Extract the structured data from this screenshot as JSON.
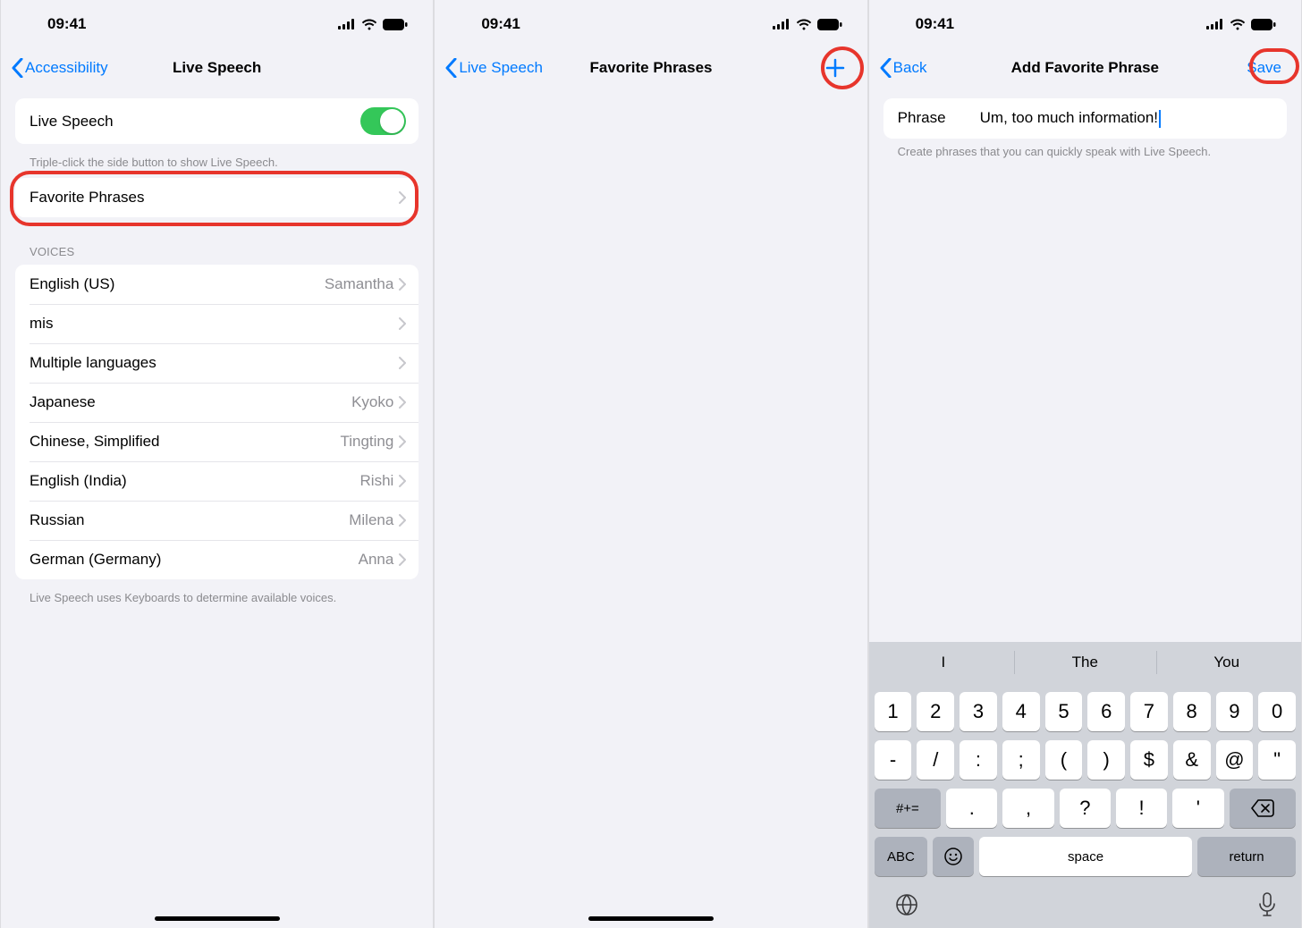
{
  "status": {
    "time": "09:41"
  },
  "screen1": {
    "back": "Accessibility",
    "title": "Live Speech",
    "toggleLabel": "Live Speech",
    "toggleFooter": "Triple-click the side button to show Live Speech.",
    "favorite": "Favorite Phrases",
    "voicesHeader": "Voices",
    "voices": [
      {
        "name": "English (US)",
        "detail": "Samantha"
      },
      {
        "name": "mis",
        "detail": ""
      },
      {
        "name": "Multiple languages",
        "detail": ""
      },
      {
        "name": "Japanese",
        "detail": "Kyoko"
      },
      {
        "name": "Chinese, Simplified",
        "detail": "Tingting"
      },
      {
        "name": "English (India)",
        "detail": "Rishi"
      },
      {
        "name": "Russian",
        "detail": "Milena"
      },
      {
        "name": "German (Germany)",
        "detail": "Anna"
      }
    ],
    "voicesFooter": "Live Speech uses Keyboards to determine available voices."
  },
  "screen2": {
    "back": "Live Speech",
    "title": "Favorite Phrases"
  },
  "screen3": {
    "back": "Back",
    "title": "Add Favorite Phrase",
    "save": "Save",
    "phraseLabel": "Phrase",
    "phraseValue": "Um, too much information!",
    "footer": "Create phrases that you can quickly speak with Live Speech.",
    "suggestions": [
      "I",
      "The",
      "You"
    ],
    "row1": [
      "1",
      "2",
      "3",
      "4",
      "5",
      "6",
      "7",
      "8",
      "9",
      "0"
    ],
    "row2": [
      "-",
      "/",
      ":",
      ";",
      "(",
      ")",
      "$",
      "&",
      "@",
      "\""
    ],
    "row3": {
      "mode": "#+=",
      "keys": [
        ".",
        ",",
        "?",
        "!",
        "'"
      ]
    },
    "row4": {
      "abc": "ABC",
      "space": "space",
      "ret": "return"
    }
  }
}
